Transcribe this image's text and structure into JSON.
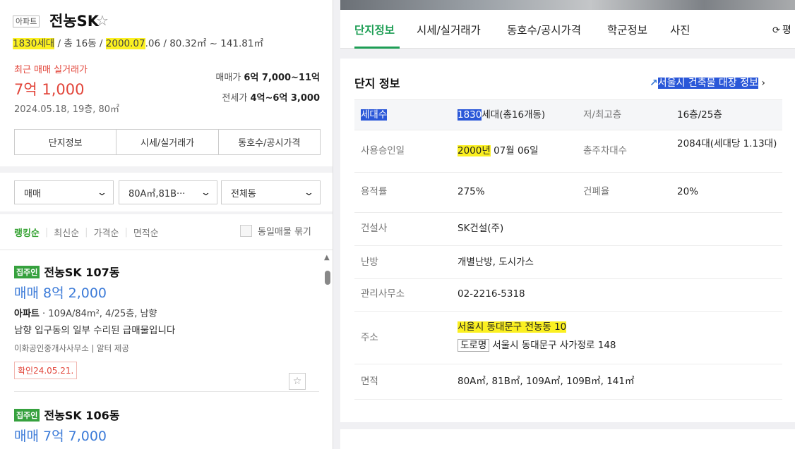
{
  "header": {
    "type_badge": "아파트",
    "complex_name": "전농SK",
    "summary": {
      "households": "1830세대",
      "sep1": " / 총 16동 / ",
      "approval_year": "2000.07",
      "approval_rest": ".06 / 80.32㎡ ~ 141.81㎡"
    },
    "recent_label": "최근 매매 실거래가",
    "recent_price": "7억 1,000",
    "recent_detail": "2024.05.18, 19층, 80㎡",
    "sale_label": "매매가",
    "sale_value": "6억 7,000~11억",
    "rent_label": "전세가",
    "rent_value": "4억~6억 3,000"
  },
  "left_tabs": [
    "단지정보",
    "시세/실거래가",
    "동호수/공시가격"
  ],
  "filters": {
    "trade_type": "매매",
    "area": "80A㎡,81B···",
    "dong": "전체동"
  },
  "sort": {
    "options": [
      "랭킹순",
      "최신순",
      "가격순",
      "면적순"
    ],
    "active": "랭킹순",
    "group_label": "동일매물 묶기"
  },
  "listings": [
    {
      "badge": "집주인",
      "title": "전농SK 107동",
      "price": "매매 8억 2,000",
      "spec_type": "아파트",
      "spec_rest": " · 109A/84m², 4/25층, 남향",
      "desc": "남향 입구동의 일부 수리된 급매물입니다",
      "agent": "이화공인중개사사무소 | 알터 제공",
      "confirm": "확인24.05.21."
    },
    {
      "badge": "집주인",
      "title": "전농SK 106동",
      "price": "매매 7억 7,000"
    }
  ],
  "nav": {
    "tabs": [
      "단지정보",
      "시세/실거래가",
      "동호수/공시가격",
      "학군정보",
      "사진"
    ],
    "active": "단지정보",
    "refresh_label": "평"
  },
  "info": {
    "title": "단지 정보",
    "registry_link": "서울시 건축물 대장 정보",
    "household_label": "세대수",
    "household_count": "1830",
    "household_rest": "세대(총16개동)",
    "floors_label": "저/최고층",
    "floors_value": "16층/25층",
    "approval_label": "사용승인일",
    "approval_year": "2000년",
    "approval_rest": " 07월 06일",
    "parking_label": "총주차대수",
    "parking_value": "2084대(세대당 1.13대)",
    "far_label": "용적률",
    "far_value": "275%",
    "bcr_label": "건폐율",
    "bcr_value": "20%",
    "builder_label": "건설사",
    "builder_value": "SK건설(주)",
    "heating_label": "난방",
    "heating_value": "개별난방, 도시가스",
    "office_label": "관리사무소",
    "office_value": "02-2216-5318",
    "address_label": "주소",
    "address_lot": "서울시 동대문구 전농동 10",
    "road_badge": "도로명",
    "address_road": "서울시 동대문구 사가정로 148",
    "area_label": "면적",
    "area_value": "80A㎡, 81B㎡, 109A㎡, 109B㎡, 141㎡"
  }
}
